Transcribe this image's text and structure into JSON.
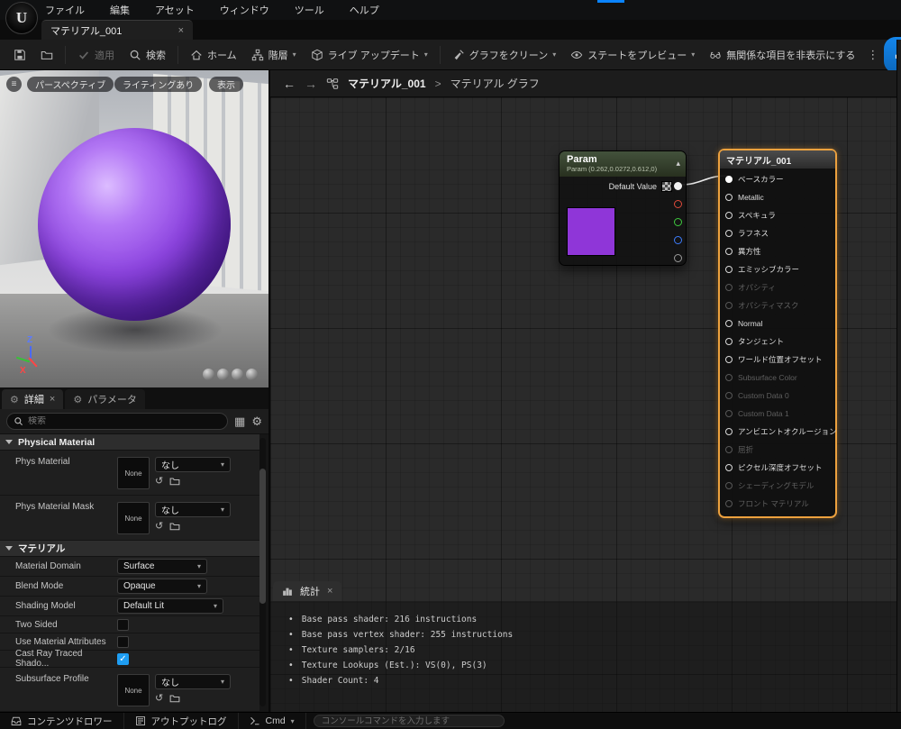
{
  "menu_bar": {
    "items": [
      "ファイル",
      "編集",
      "アセット",
      "ウィンドウ",
      "ツール",
      "ヘルプ"
    ]
  },
  "tab": {
    "title": "マテリアル_001"
  },
  "toolbar": {
    "apply_label": "適用",
    "search_label": "検索",
    "home_label": "ホーム",
    "hierarchy_label": "階層",
    "live_update_label": "ライブ アップデート",
    "clean_graph_label": "グラフをクリーン",
    "preview_state_label": "ステートをプレビュー",
    "hide_unrelated_label": "無関係な項目を非表示にする",
    "stats_label": "統計"
  },
  "viewport": {
    "perspective_label": "パースペクティブ",
    "lit_label": "ライティングあり",
    "show_label": "表示",
    "axis_z": "Z",
    "axis_x": "X"
  },
  "details": {
    "tab_details": "詳細",
    "tab_parameters": "パラメータ",
    "search_placeholder": "検索",
    "section_physical_material": "Physical Material",
    "section_material": "マテリアル",
    "phys_material": {
      "label": "Phys Material",
      "thumb": "None",
      "value": "なし"
    },
    "phys_material_mask": {
      "label": "Phys Material Mask",
      "thumb": "None",
      "value": "なし"
    },
    "material_domain": {
      "label": "Material Domain",
      "value": "Surface"
    },
    "blend_mode": {
      "label": "Blend Mode",
      "value": "Opaque"
    },
    "shading_model": {
      "label": "Shading Model",
      "value": "Default Lit"
    },
    "two_sided": {
      "label": "Two Sided",
      "checked": false
    },
    "use_material_attributes": {
      "label": "Use Material Attributes",
      "checked": false
    },
    "cast_ray_traced": {
      "label": "Cast Ray Traced Shado...",
      "checked": true
    },
    "subsurface_profile": {
      "label": "Subsurface Profile",
      "thumb": "None",
      "value": "なし"
    }
  },
  "graph": {
    "breadcrumb_root": "マテリアル_001",
    "breadcrumb_sep": ">",
    "breadcrumb_current": "マテリアル グラフ"
  },
  "param_node": {
    "title": "Param",
    "subtitle": "Param (0.262,0.0272,0.612,0)",
    "default_value_label": "Default Value",
    "swatch_color": "#8f36d8"
  },
  "material_node": {
    "title": "マテリアル_001",
    "pins": [
      {
        "label": "ベースカラー",
        "on": true,
        "connected": true
      },
      {
        "label": "Metallic",
        "on": true
      },
      {
        "label": "スペキュラ",
        "on": true
      },
      {
        "label": "ラフネス",
        "on": true
      },
      {
        "label": "異方性",
        "on": true
      },
      {
        "label": "エミッシブカラー",
        "on": true
      },
      {
        "label": "オパシティ",
        "on": false
      },
      {
        "label": "オパシティマスク",
        "on": false
      },
      {
        "label": "Normal",
        "on": true
      },
      {
        "label": "タンジェント",
        "on": true
      },
      {
        "label": "ワールド位置オフセット",
        "on": true
      },
      {
        "label": "Subsurface Color",
        "on": false
      },
      {
        "label": "Custom Data 0",
        "on": false
      },
      {
        "label": "Custom Data 1",
        "on": false
      },
      {
        "label": "アンビエントオクルージョン",
        "on": true
      },
      {
        "label": "屈折",
        "on": false
      },
      {
        "label": "ピクセル深度オフセット",
        "on": true
      },
      {
        "label": "シェーディングモデル",
        "on": false
      },
      {
        "label": "フロント マテリアル",
        "on": false
      }
    ]
  },
  "stats_panel": {
    "tab_label": "統計",
    "lines": [
      "Base pass shader: 216 instructions",
      "Base pass vertex shader: 255 instructions",
      "Texture samplers: 2/16",
      "Texture Lookups (Est.): VS(0), PS(3)",
      "Shader Count: 4"
    ]
  },
  "status_bar": {
    "content_drawer_label": "コンテンツドロワー",
    "output_log_label": "アウトプットログ",
    "cmd_label": "Cmd",
    "console_placeholder": "コンソールコマンドを入力します"
  },
  "ui": {
    "close": "×",
    "caret": "▾",
    "chevron_up": "▴",
    "back": "←",
    "forward": "→",
    "menu": "≡",
    "kebab": "⋮",
    "grid_view": "▦",
    "gear": "⚙",
    "reuse": "↺",
    "logo": "U"
  },
  "colors": {
    "accent_blue": "#0f78d7",
    "selection_orange": "#eda13e",
    "param_swatch": "#8f36d8",
    "checkbox_checked": "#1e9df2"
  }
}
